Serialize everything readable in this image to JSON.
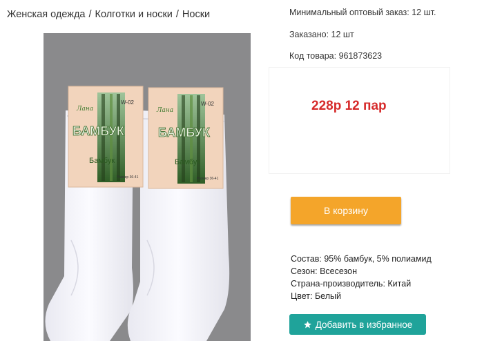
{
  "breadcrumb": {
    "items": [
      "Женская одежда",
      "Колготки и носки",
      "Носки"
    ],
    "separator": "/"
  },
  "product": {
    "image_alt": "Белые носки в упаковке",
    "package_label": {
      "brand_small": "Лана",
      "model": "W-02",
      "title_big": "БАМБУК",
      "title_small": "Бамбук",
      "size_text": "Размер 36-41"
    },
    "min_order": "Минимальный оптовый заказ: 12 шт.",
    "ordered": "Заказано: 12 шт",
    "sku": "Код товара: 961873623",
    "price": "228р 12 пар",
    "add_to_cart": "В корзину",
    "properties": [
      "Состав: 95% бамбук, 5% полиамид",
      "Сезон: Всесезон",
      "Страна-производитель: Китай",
      "Цвет: Белый"
    ],
    "add_to_favorites": "Добавить в избранное"
  },
  "colors": {
    "photo_bg": "#8a8a8c",
    "price": "#d62a2a",
    "cart_button": "#f4a52a",
    "favorite_button": "#1fa39a",
    "package_card": "#f2d4bc",
    "bamboo": "#3f7a2e"
  },
  "icons": {
    "favorite": "star-icon"
  }
}
